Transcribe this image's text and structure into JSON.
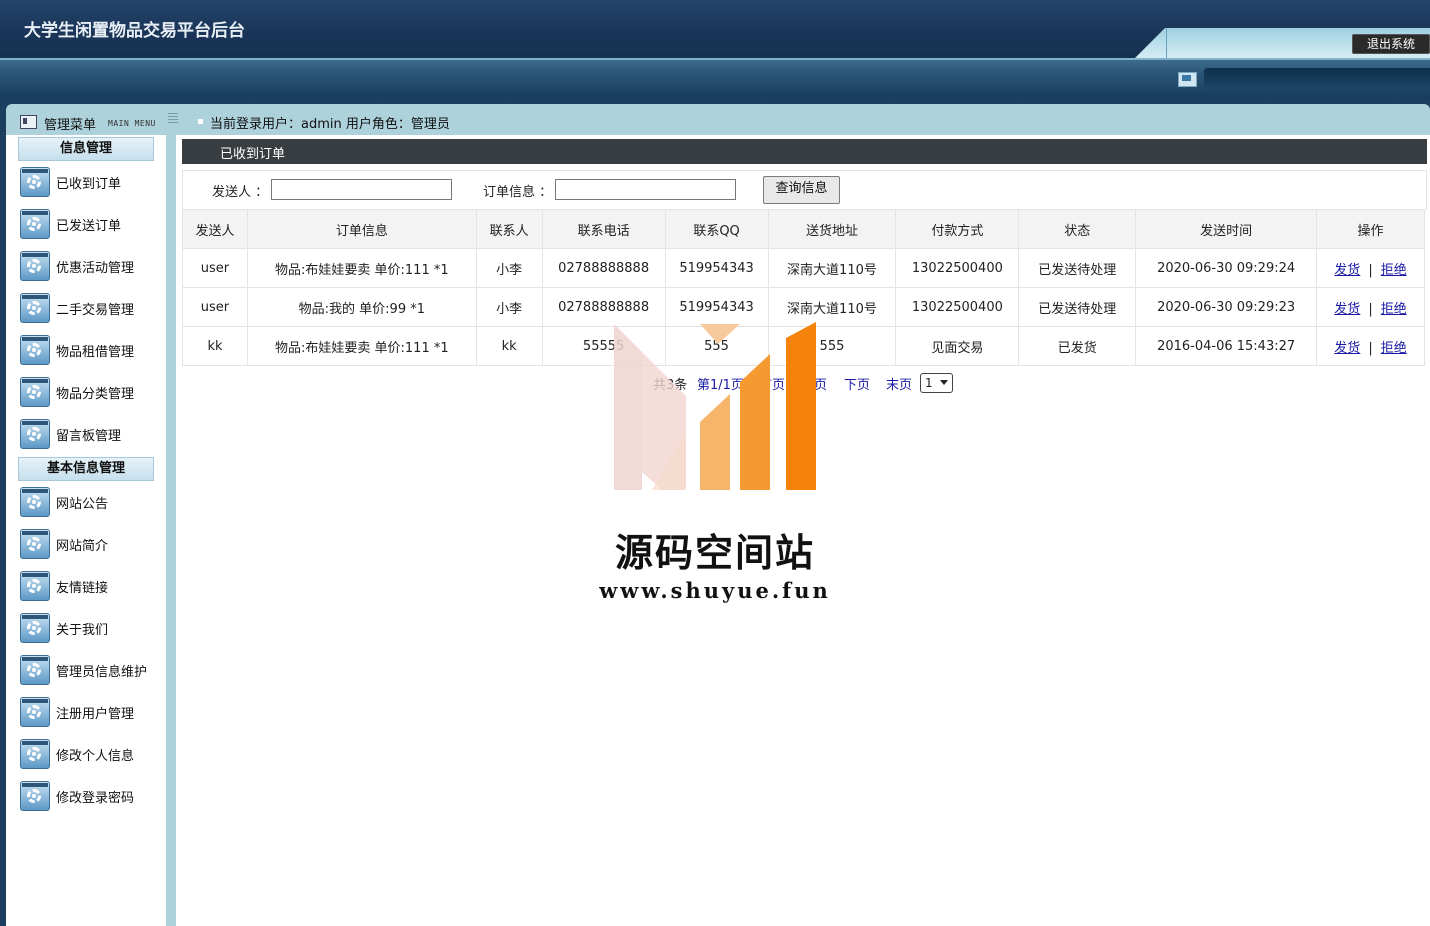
{
  "header": {
    "site_title": "大学生闲置物品交易平台后台",
    "logout_label": "退出系统"
  },
  "topbar": {
    "menu_title": "管理菜单",
    "menu_subtitle": "MAIN MENU",
    "current_user_label": "当前登录用户：admin  用户角色：管理员"
  },
  "sidebar": {
    "sections": [
      {
        "title": "信息管理",
        "items": [
          "已收到订单",
          "已发送订单",
          "优惠活动管理",
          "二手交易管理",
          "物品租借管理",
          "物品分类管理",
          "留言板管理"
        ]
      },
      {
        "title": "基本信息管理",
        "items": [
          "网站公告",
          "网站简介",
          "友情链接",
          "关于我们",
          "管理员信息维护",
          "注册用户管理",
          "修改个人信息",
          "修改登录密码"
        ]
      }
    ]
  },
  "panel": {
    "title": "已收到订单",
    "search": {
      "sender_label": "发送人 ：",
      "sender_value": "",
      "order_label": "订单信息 ：",
      "order_value": "",
      "button_label": "查询信息"
    },
    "table": {
      "headers": [
        "发送人",
        "订单信息",
        "联系人",
        "联系电话",
        "联系QQ",
        "送货地址",
        "付款方式",
        "状态",
        "发送时间",
        "操作"
      ],
      "rows": [
        [
          "user",
          "物品:布娃娃要卖 单价:111 *1",
          "小李",
          "02788888888",
          "519954343",
          "深南大道110号",
          "13022500400",
          "已发送待处理",
          "2020-06-30 09:29:24"
        ],
        [
          "user",
          "物品:我的 单价:99 *1",
          "小李",
          "02788888888",
          "519954343",
          "深南大道110号",
          "13022500400",
          "已发送待处理",
          "2020-06-30 09:29:23"
        ],
        [
          "kk",
          "物品:布娃娃要卖 单价:111 *1",
          "kk",
          "55555",
          "555",
          "555",
          "见面交易",
          "已发货",
          "2016-04-06 15:43:27"
        ]
      ],
      "action_ship": "发货",
      "action_sep": "|",
      "action_reject": "拒绝"
    },
    "pager": {
      "total": "共3条",
      "page_info": "第1/1页",
      "first": "首页",
      "prev": "上页",
      "next": "下页",
      "last": "末页",
      "page_select": "1"
    }
  },
  "watermark": {
    "title": "源码空间站",
    "url": "www.shuyue.fun"
  },
  "colors": {
    "header_bg": "#1a3558",
    "frame_accent": "#aed2dc",
    "panel_title_bg": "#383d41",
    "link": "#1a1aa6",
    "watermark_orange": "#f5820a"
  },
  "icons": {
    "menu_item_icon": "gear-icon",
    "menu_header_icon": "menu-icon",
    "nav_icon": "monitor-icon"
  }
}
